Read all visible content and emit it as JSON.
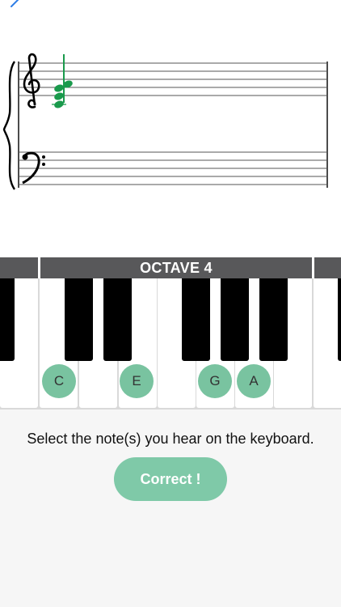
{
  "nav": {
    "back_icon": "chevron-left-icon"
  },
  "staff": {
    "clefs": [
      "treble-clef-icon",
      "bass-clef-icon"
    ],
    "chord_color": "#1a9a4c",
    "chord_notes": [
      "C4",
      "E4",
      "G4",
      "A4"
    ]
  },
  "keyboard": {
    "octave_label": "OCTAVE 4",
    "bar_color": "#58585a",
    "marker_color": "#79c3a0",
    "selected_notes": [
      "C",
      "E",
      "G",
      "A"
    ]
  },
  "prompt": {
    "instruction": "Select the note(s) you hear on the keyboard.",
    "result_label": "Correct !"
  },
  "colors": {
    "accent": "#7fc9a8",
    "link": "#2f7ee6"
  }
}
